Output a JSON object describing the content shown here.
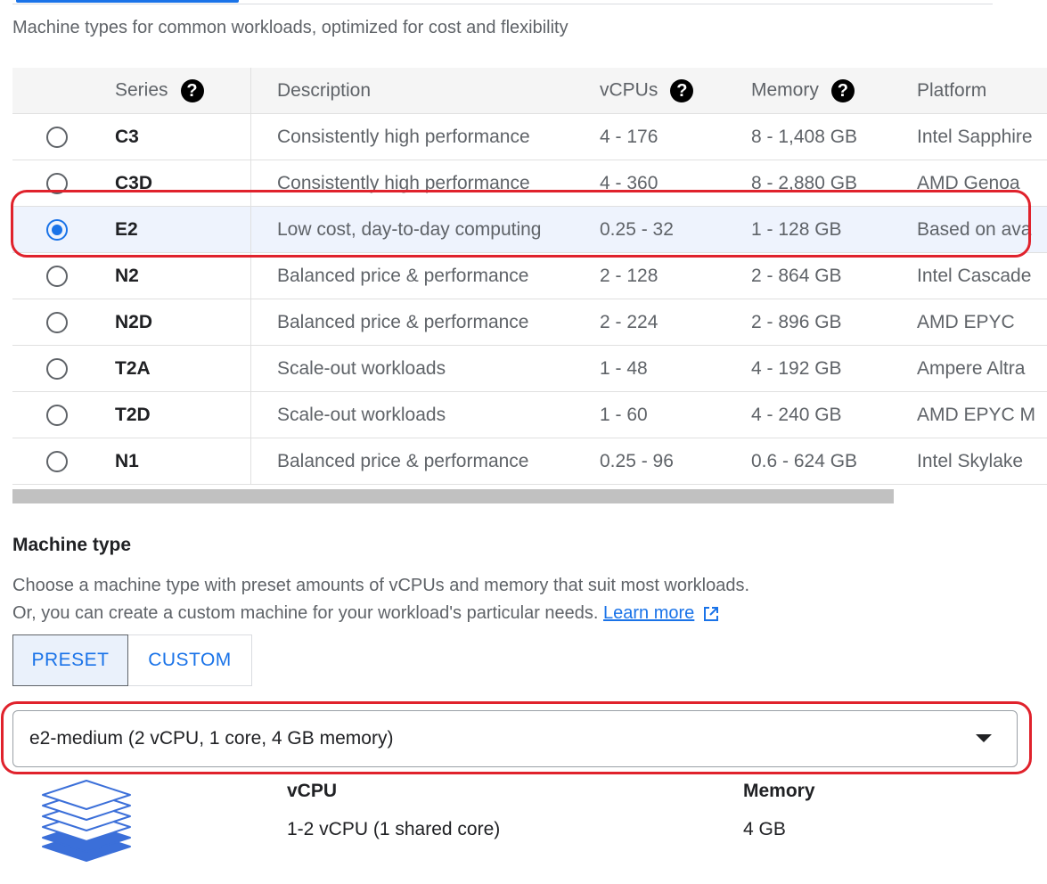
{
  "intro": "Machine types for common workloads, optimized for cost and flexibility",
  "table": {
    "headers": {
      "series": "Series",
      "description": "Description",
      "vcpus": "vCPUs",
      "memory": "Memory",
      "platform": "Platform"
    },
    "help_glyph": "?",
    "rows": [
      {
        "series": "C3",
        "description": "Consistently high performance",
        "vcpus": "4 - 176",
        "memory": "8 - 1,408 GB",
        "platform": "Intel Sapphire",
        "selected": false
      },
      {
        "series": "C3D",
        "description": "Consistently high performance",
        "vcpus": "4 - 360",
        "memory": "8 - 2,880 GB",
        "platform": "AMD Genoa",
        "selected": false
      },
      {
        "series": "E2",
        "description": "Low cost, day-to-day computing",
        "vcpus": "0.25 - 32",
        "memory": "1 - 128 GB",
        "platform": "Based on ava",
        "selected": true
      },
      {
        "series": "N2",
        "description": "Balanced price & performance",
        "vcpus": "2 - 128",
        "memory": "2 - 864 GB",
        "platform": "Intel Cascade",
        "selected": false
      },
      {
        "series": "N2D",
        "description": "Balanced price & performance",
        "vcpus": "2 - 224",
        "memory": "2 - 896 GB",
        "platform": "AMD EPYC",
        "selected": false
      },
      {
        "series": "T2A",
        "description": "Scale-out workloads",
        "vcpus": "1 - 48",
        "memory": "4 - 192 GB",
        "platform": "Ampere Altra",
        "selected": false
      },
      {
        "series": "T2D",
        "description": "Scale-out workloads",
        "vcpus": "1 - 60",
        "memory": "4 - 240 GB",
        "platform": "AMD EPYC M",
        "selected": false
      },
      {
        "series": "N1",
        "description": "Balanced price & performance",
        "vcpus": "0.25 - 96",
        "memory": "0.6 - 624 GB",
        "platform": "Intel Skylake",
        "selected": false
      }
    ]
  },
  "machine_type": {
    "title": "Machine type",
    "desc_line1": "Choose a machine type with preset amounts of vCPUs and memory that suit most workloads.",
    "desc_line2": "Or, you can create a custom machine for your workload's particular needs.",
    "learn_more": "Learn more",
    "preset_label": "PRESET",
    "custom_label": "CUSTOM",
    "selected_preset": "PRESET",
    "select_value": "e2-medium (2 vCPU, 1 core, 4 GB memory)",
    "vcpu_label": "vCPU",
    "vcpu_value": "1-2 vCPU (1 shared core)",
    "memory_label": "Memory",
    "memory_value": "4 GB"
  },
  "colors": {
    "accent": "#1a73e8",
    "highlight_outline": "#e0222c",
    "selected_row_bg": "#eef3fd"
  },
  "icons": [
    "help-icon",
    "radio-icon",
    "external-link-icon",
    "chevron-down-icon",
    "layers-icon"
  ]
}
